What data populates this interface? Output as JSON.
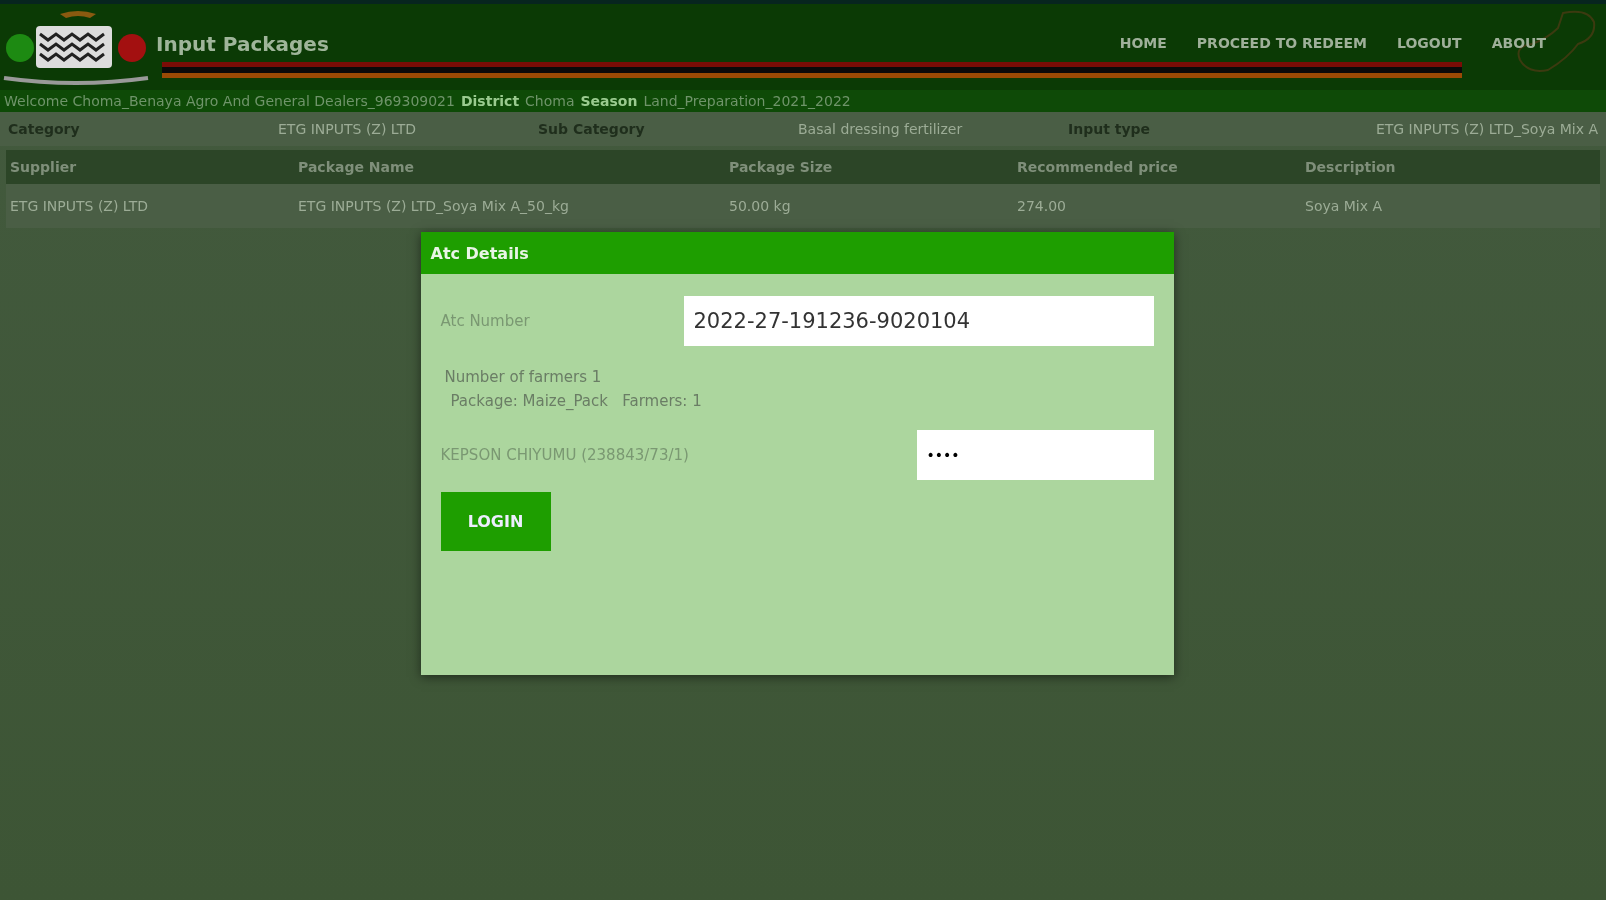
{
  "header": {
    "title": "Input Packages",
    "nav": [
      {
        "label": "HOME"
      },
      {
        "label": "PROCEED TO REDEEM"
      },
      {
        "label": "LOGOUT"
      },
      {
        "label": "ABOUT"
      }
    ]
  },
  "info_bar": [
    {
      "kind": "value",
      "text": "Welcome Choma_Benaya Agro And General Dealers_969309021"
    },
    {
      "kind": "label",
      "text": "District"
    },
    {
      "kind": "value",
      "text": "Choma"
    },
    {
      "kind": "label",
      "text": "Season"
    },
    {
      "kind": "value",
      "text": "Land_Preparation_2021_2022"
    }
  ],
  "filters": [
    {
      "label": "Category",
      "value": "ETG INPUTS (Z) LTD"
    },
    {
      "label": "Sub Category",
      "value": "Basal dressing fertilizer"
    },
    {
      "label": "Input type",
      "value": "ETG INPUTS (Z) LTD_Soya Mix A"
    }
  ],
  "table": {
    "columns": [
      "Supplier",
      "Package Name",
      "Package Size",
      "Recommended price",
      "Description"
    ],
    "rows": [
      [
        "ETG INPUTS (Z) LTD",
        "ETG INPUTS (Z) LTD_Soya Mix A_50_kg",
        "50.00 kg",
        "274.00",
        "Soya Mix A"
      ]
    ]
  },
  "dialog": {
    "title": "Atc Details",
    "atc_label": "Atc Number",
    "atc_value": "2022-27-191236-9020104",
    "farmers_count": "Number of farmers 1",
    "package_line": "Package: Maize_Pack   Farmers: 1",
    "farmer_name": "KEPSON CHIYUMU (238843/73/1)",
    "pin_value": "••••",
    "button": "LOGIN"
  }
}
